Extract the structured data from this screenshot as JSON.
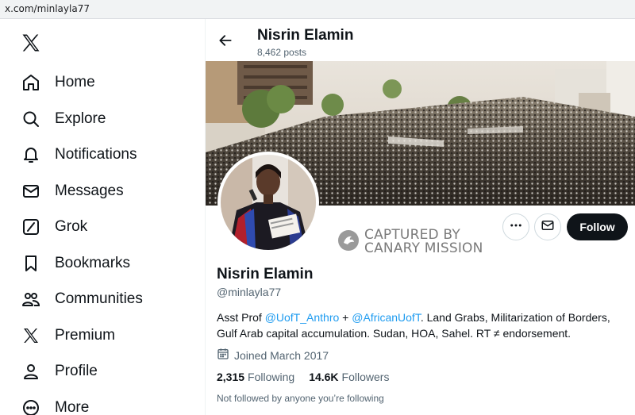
{
  "browser": {
    "url": "x.com/minlayla77"
  },
  "sidebar": {
    "logo_icon": "x-logo-icon",
    "items": [
      {
        "label": "Home",
        "icon": "home-icon"
      },
      {
        "label": "Explore",
        "icon": "search-icon"
      },
      {
        "label": "Notifications",
        "icon": "bell-icon"
      },
      {
        "label": "Messages",
        "icon": "envelope-icon"
      },
      {
        "label": "Grok",
        "icon": "grok-icon"
      },
      {
        "label": "Bookmarks",
        "icon": "bookmark-icon"
      },
      {
        "label": "Communities",
        "icon": "communities-icon"
      },
      {
        "label": "Premium",
        "icon": "x-logo-icon"
      },
      {
        "label": "Profile",
        "icon": "person-icon"
      },
      {
        "label": "More",
        "icon": "more-circle-icon"
      }
    ]
  },
  "header": {
    "name": "Nisrin Elamin",
    "posts": "8,462 posts"
  },
  "actions": {
    "follow_label": "Follow",
    "more_icon": "ellipsis-icon",
    "message_icon": "envelope-icon"
  },
  "watermark": {
    "line1": "CAPTURED BY",
    "line2": "CANARY MISSION"
  },
  "profile": {
    "name": "Nisrin Elamin",
    "handle": "@minlayla77",
    "bio": {
      "prefix": "Asst Prof ",
      "mention1": "@UofT_Anthro",
      "mid": " + ",
      "mention2": "@AfricanUofT",
      "suffix": ". Land Grabs, Militarization of Borders, Gulf Arab capital accumulation. Sudan, HOA, Sahel. RT ≠ endorsement."
    },
    "joined": "Joined March 2017",
    "following_count": "2,315",
    "following_label": "Following",
    "followers_count": "14.6K",
    "followers_label": "Followers",
    "not_followed": "Not followed by anyone you’re following"
  },
  "colors": {
    "accent": "#1d9bf0",
    "text": "#0f1419",
    "muted": "#536471"
  }
}
